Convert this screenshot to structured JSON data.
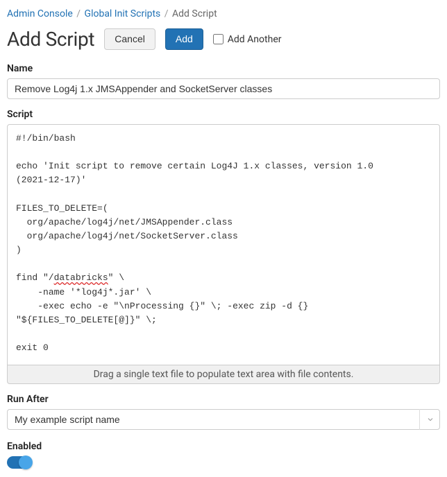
{
  "breadcrumb": {
    "admin": "Admin Console",
    "global": "Global Init Scripts",
    "current": "Add Script"
  },
  "header": {
    "title": "Add Script",
    "cancel": "Cancel",
    "add": "Add",
    "add_another": "Add Another"
  },
  "name": {
    "label": "Name",
    "value": "Remove Log4j 1.x JMSAppender and SocketServer classes"
  },
  "script": {
    "label": "Script",
    "line1": "#!/bin/bash",
    "line2a": "echo 'Init script to remove certain Log4J 1.x classes, version 1.0",
    "line2b": "(2021-12-17)'",
    "line3": "FILES_TO_DELETE=(",
    "line4": "  org/apache/log4j/net/JMSAppender.class",
    "line5": "  org/apache/log4j/net/SocketServer.class",
    "line6": ")",
    "line7a": "find \"/",
    "spellword": "databricks",
    "line7b": "\" \\",
    "line8": "    -name '*log4j*.jar' \\",
    "line9": "    -exec echo -e \"\\nProcessing {}\" \\; -exec zip -d {}",
    "line10": "\"${FILES_TO_DELETE[@]}\" \\;",
    "line11": "exit 0",
    "dropzone": "Drag a single text file to populate text area with file contents."
  },
  "run_after": {
    "label": "Run After",
    "value": "My example script name"
  },
  "enabled": {
    "label": "Enabled"
  }
}
